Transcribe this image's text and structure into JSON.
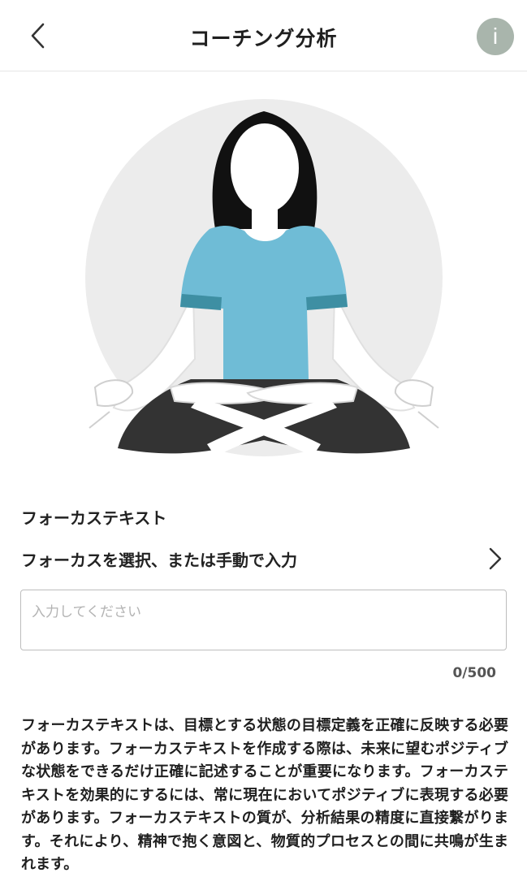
{
  "header": {
    "title": "コーチング分析",
    "back_icon": "chevron-left-icon",
    "info_label": "i"
  },
  "illustration": {
    "name": "meditation-illustration",
    "colors": {
      "circle": "#ececec",
      "hair": "#111111",
      "shirt": "#6fbcd6",
      "sleeve_band": "#3e8fa3",
      "pants": "#333333",
      "skin": "#ffffff"
    }
  },
  "focus": {
    "section_label": "フォーカステキスト",
    "select_label": "フォーカスを選択、または手動で入力",
    "select_icon": "chevron-right-icon",
    "input_value": "",
    "input_placeholder": "入力してください",
    "counter": "0/500"
  },
  "description": "フォーカステキストは、目標とする状態の目標定義を正確に反映する必要があります。フォーカステキストを作成する際は、未来に望むポジティブな状態をできるだけ正確に記述することが重要になります。フォーカステキストを効果的にするには、常に現在においてポジティブに表現する必要があります。フォーカステキストの質が、分析結果の精度に直接繋がります。それにより、精神で抱く意図と、物質的プロセスとの間に共鳴が生まれます。"
}
